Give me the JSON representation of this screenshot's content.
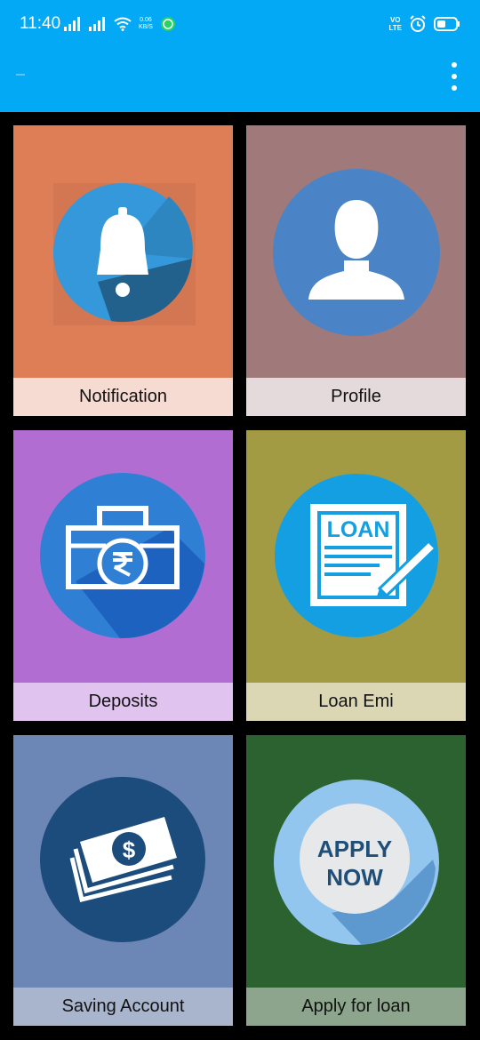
{
  "status_bar": {
    "time": "11:40",
    "net_speed_value": "0.06",
    "net_speed_unit": "KB/S",
    "volte_top": "VO",
    "volte_bottom": "LTE"
  },
  "colors": {
    "app_bar": "#03A9F4",
    "background": "#000000"
  },
  "tiles": [
    {
      "label": "Notification",
      "icon": "bell-icon",
      "color": "#DE7E56"
    },
    {
      "label": "Profile",
      "icon": "user-icon",
      "color": "#A0797A"
    },
    {
      "label": "Deposits",
      "icon": "briefcase-rupee-icon",
      "color": "#B26DD3"
    },
    {
      "label": "Loan Emi",
      "icon": "loan-document-icon",
      "color": "#A39B44",
      "icon_text": "LOAN"
    },
    {
      "label": "Saving Account",
      "icon": "money-bills-icon",
      "color": "#6C86B6",
      "icon_text": "$"
    },
    {
      "label": "Apply for loan",
      "icon": "apply-now-badge-icon",
      "color": "#2B6230",
      "icon_text_1": "APPLY",
      "icon_text_2": "NOW"
    }
  ]
}
